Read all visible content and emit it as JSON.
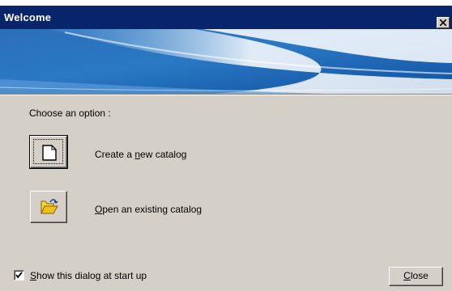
{
  "window": {
    "title": "Welcome"
  },
  "main": {
    "choose_label": "Choose an option :",
    "options": [
      {
        "label_pre": "Create a ",
        "label_key": "n",
        "label_post": "ew catalog",
        "icon": "new-document-icon"
      },
      {
        "label_pre": "",
        "label_key": "O",
        "label_post": "pen an existing catalog",
        "icon": "open-folder-icon"
      }
    ]
  },
  "footer": {
    "show_at_startup": {
      "checked": true,
      "label_pre": "",
      "label_key": "S",
      "label_post": "how this dialog at start up"
    },
    "close_button": {
      "label_key": "C",
      "label_post": "lose"
    }
  },
  "colors": {
    "title_bar": "#08246b",
    "face": "#d4d0c8",
    "banner_dark": "#1a5aa8",
    "banner_light": "#e8f0f8"
  }
}
